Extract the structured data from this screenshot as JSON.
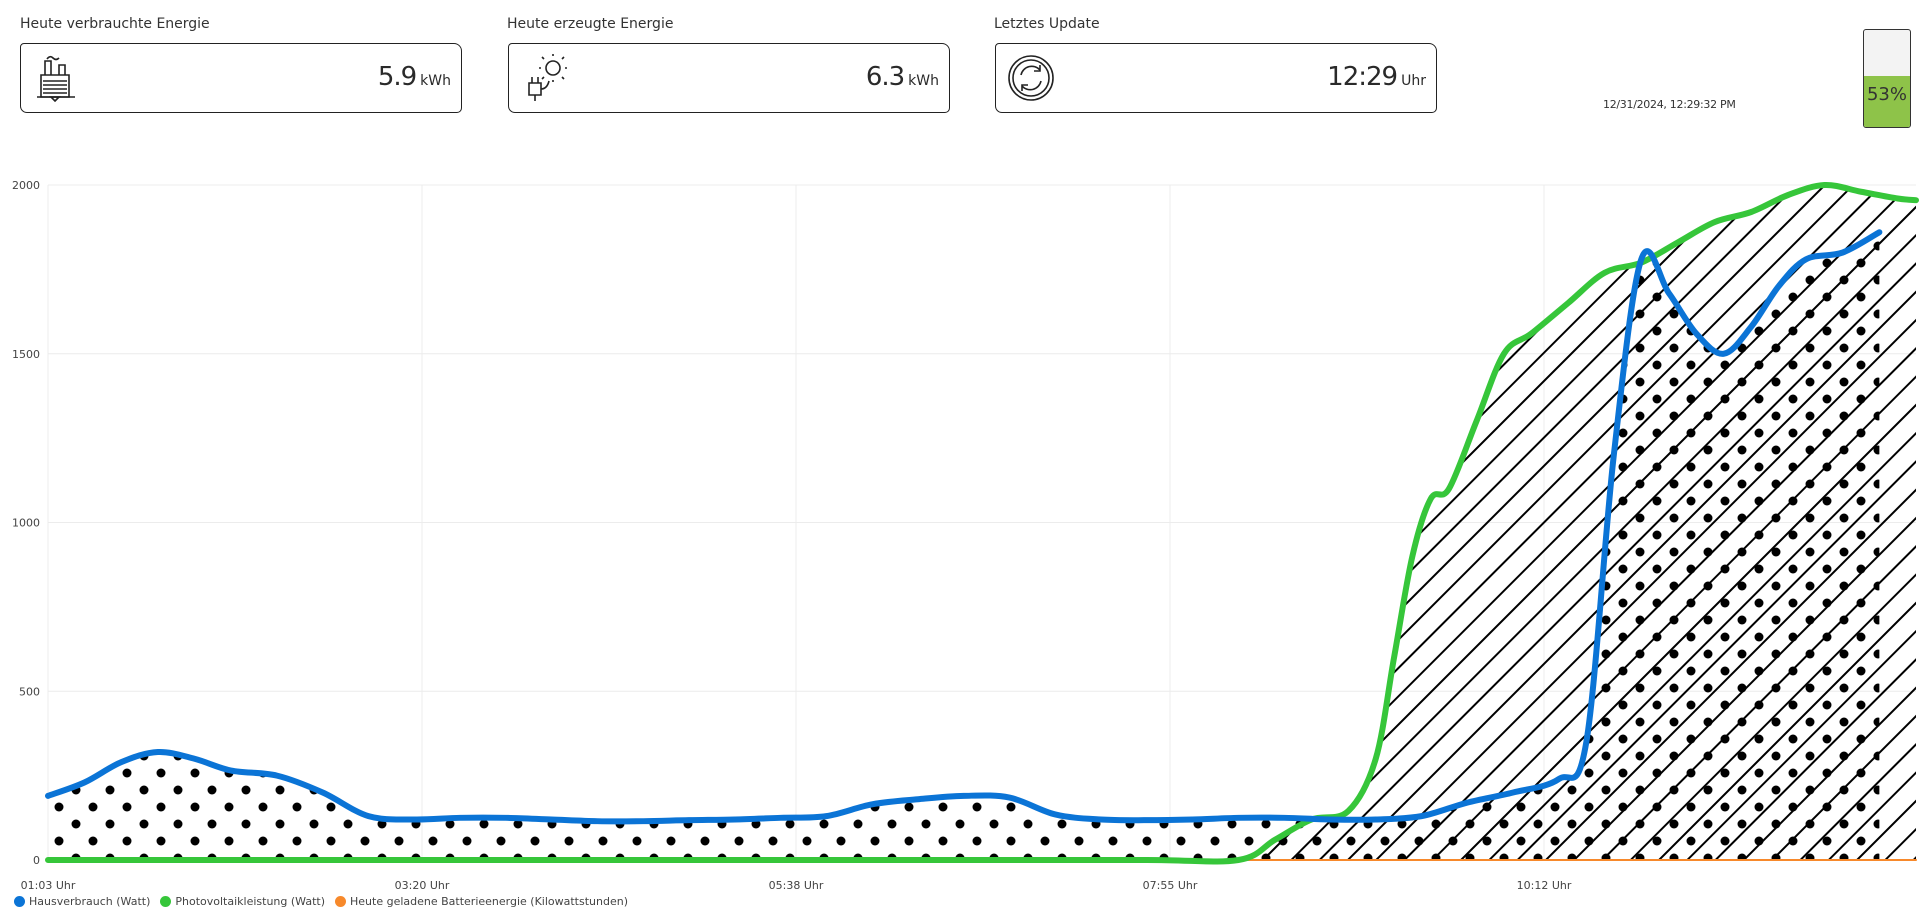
{
  "cards": [
    {
      "title": "Heute verbrauchte Energie",
      "value": "5.9",
      "unit": "kWh",
      "icon": "factory-icon"
    },
    {
      "title": "Heute erzeugte Energie",
      "value": "6.3",
      "unit": "kWh",
      "icon": "solar-plug-icon"
    },
    {
      "title": "Letztes Update",
      "value": "12:29",
      "unit": "Uhr",
      "icon": "refresh-icon"
    }
  ],
  "timestamp": "12/31/2024, 12:29:32 PM",
  "battery": {
    "percent_label": "53%",
    "level": 0.53,
    "color": "#8ec349"
  },
  "colors": {
    "consumption": "#0b74d6",
    "pv": "#36c63a",
    "battery": "#f7892b"
  },
  "chart_data": {
    "type": "area",
    "x_tick_labels": [
      "01:03 Uhr",
      "03:20 Uhr",
      "05:38 Uhr",
      "07:55 Uhr",
      "10:12 Uhr"
    ],
    "y_ticks": [
      0,
      500,
      1000,
      1500,
      2000
    ],
    "ylim": [
      0,
      2000
    ],
    "grid": true,
    "legend_position": "bottom-left",
    "series": [
      {
        "name": "Hausverbrauch (Watt)",
        "pattern": "dots",
        "points": [
          [
            0,
            190
          ],
          [
            20,
            230
          ],
          [
            40,
            290
          ],
          [
            60,
            320
          ],
          [
            80,
            300
          ],
          [
            100,
            265
          ],
          [
            125,
            250
          ],
          [
            150,
            200
          ],
          [
            175,
            130
          ],
          [
            200,
            120
          ],
          [
            225,
            125
          ],
          [
            250,
            125
          ],
          [
            275,
            120
          ],
          [
            300,
            115
          ],
          [
            325,
            115
          ],
          [
            350,
            118
          ],
          [
            375,
            120
          ],
          [
            400,
            125
          ],
          [
            425,
            130
          ],
          [
            450,
            165
          ],
          [
            475,
            180
          ],
          [
            500,
            190
          ],
          [
            525,
            185
          ],
          [
            550,
            135
          ],
          [
            575,
            120
          ],
          [
            600,
            118
          ],
          [
            625,
            120
          ],
          [
            650,
            125
          ],
          [
            675,
            125
          ],
          [
            700,
            120
          ],
          [
            725,
            120
          ],
          [
            750,
            130
          ],
          [
            775,
            170
          ],
          [
            800,
            200
          ],
          [
            825,
            240
          ],
          [
            840,
            350
          ],
          [
            855,
            1200
          ],
          [
            870,
            1780
          ],
          [
            885,
            1680
          ],
          [
            900,
            1560
          ],
          [
            915,
            1500
          ],
          [
            930,
            1580
          ],
          [
            945,
            1700
          ],
          [
            960,
            1780
          ],
          [
            980,
            1800
          ],
          [
            1000,
            1860
          ]
        ]
      },
      {
        "name": "Photovoltaikleistung (Watt)",
        "pattern": "hatch",
        "points": [
          [
            0,
            0
          ],
          [
            100,
            0
          ],
          [
            200,
            0
          ],
          [
            300,
            0
          ],
          [
            400,
            0
          ],
          [
            500,
            0
          ],
          [
            600,
            0
          ],
          [
            650,
            0
          ],
          [
            670,
            60
          ],
          [
            690,
            120
          ],
          [
            710,
            145
          ],
          [
            725,
            300
          ],
          [
            735,
            600
          ],
          [
            745,
            900
          ],
          [
            755,
            1070
          ],
          [
            765,
            1100
          ],
          [
            780,
            1300
          ],
          [
            795,
            1500
          ],
          [
            810,
            1560
          ],
          [
            830,
            1650
          ],
          [
            850,
            1740
          ],
          [
            870,
            1770
          ],
          [
            890,
            1830
          ],
          [
            910,
            1890
          ],
          [
            930,
            1920
          ],
          [
            950,
            1970
          ],
          [
            970,
            2000
          ],
          [
            990,
            1980
          ],
          [
            1010,
            1960
          ],
          [
            1020,
            1955
          ]
        ]
      },
      {
        "name": "Heute geladene Batterieenergie (Kilowattstunden)",
        "points": [
          [
            0,
            0
          ],
          [
            1020,
            0
          ]
        ]
      }
    ]
  }
}
